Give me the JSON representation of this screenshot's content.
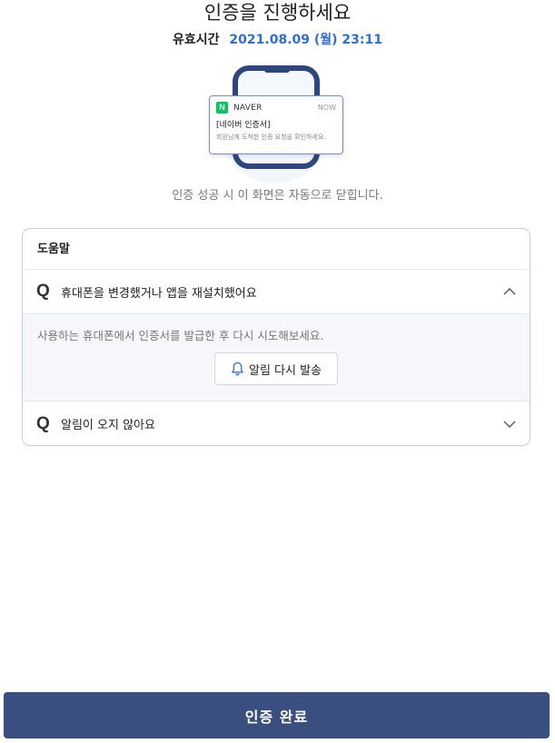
{
  "header": {
    "title": "인증을 진행하세요",
    "validity_label": "유효시간",
    "validity_value": "2021.08.09 (월) 23:11"
  },
  "notification": {
    "badge": "N",
    "brand": "NAVER",
    "time": "NOW",
    "heading": "[네이버 인증서]",
    "message": "회원님께 도착한 인증 요청을 확인하세요."
  },
  "auto_close_text": "인증 성공 시 이 화면은 자동으로 닫힙니다.",
  "help": {
    "title": "도움말",
    "q_mark": "Q",
    "items": [
      {
        "question": "휴대폰을 변경했거나 앱을 재설치했어요",
        "expanded": true,
        "answer": "사용하는 휴대폰에서 인증서를 발급한 후 다시 시도해보세요.",
        "button_label": "알림 다시 발송"
      },
      {
        "question": "알림이 오지 않아요",
        "expanded": false
      }
    ]
  },
  "footer": {
    "complete_label": "인증 완료"
  },
  "colors": {
    "accent": "#2f6fd1",
    "primary_button": "#3b4e80",
    "naver_green": "#03c75a",
    "phone": "#2f4580"
  },
  "icons": {
    "chevron_up": "chevron-up-icon",
    "chevron_down": "chevron-down-icon",
    "bell": "bell-icon"
  }
}
